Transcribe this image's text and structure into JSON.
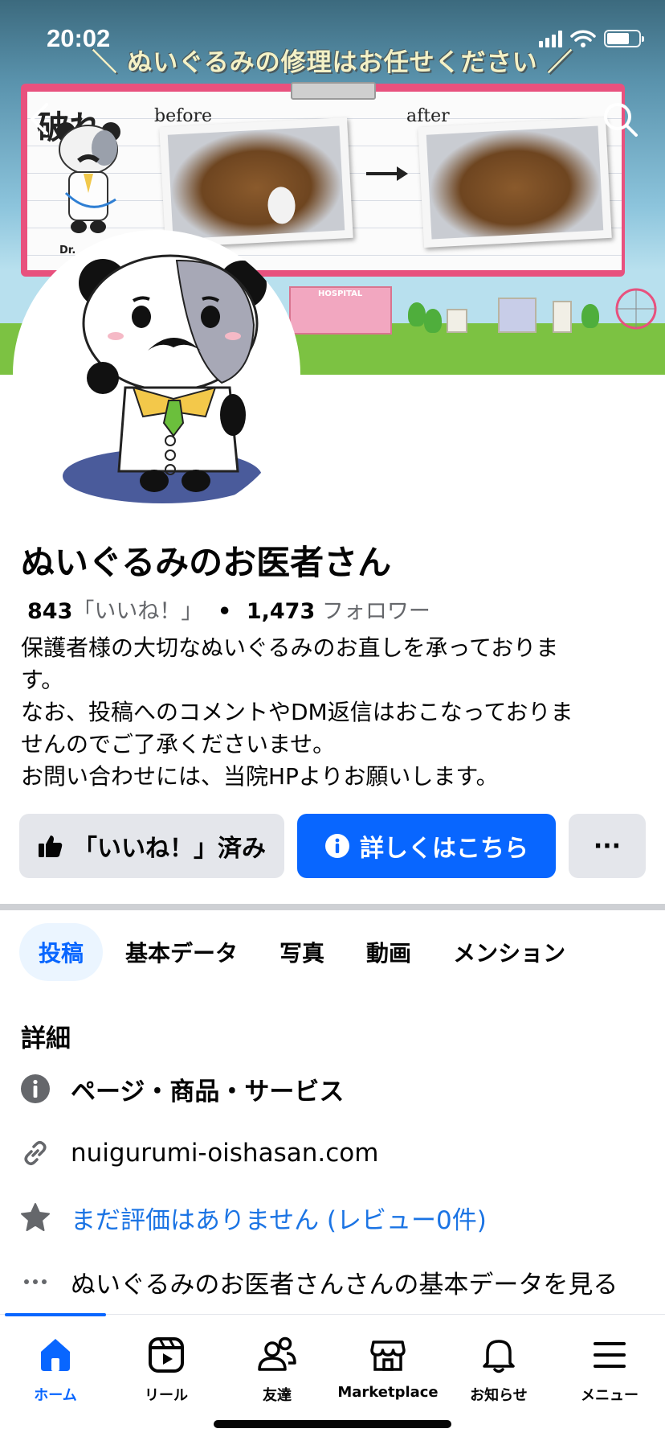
{
  "status_bar": {
    "time": "20:02",
    "icons": [
      "cellular-signal-icon",
      "wifi-icon",
      "battery-icon"
    ]
  },
  "cover": {
    "headline": "＼ ぬいぐるみの修理はお任せください ／",
    "label_tear": "破れ",
    "label_before": "before",
    "label_after": "after",
    "label_dr": "Dr.",
    "label_hospital": "HOSPITAL"
  },
  "top_nav": {
    "back_icon": "chevron-left-icon",
    "search_icon": "search-icon"
  },
  "profile": {
    "name": "ぬいぐるみのお医者さん",
    "likes_count": "843",
    "likes_label": "「いいね！」",
    "separator": "•",
    "followers_count": "1,473",
    "followers_label": "フォロワー",
    "bio_lines": [
      "保護者様の大切なぬいぐるみのお直しを承っておりま",
      "す。",
      "なお、投稿へのコメントやDM返信はおこなっておりま",
      "せんのでご了承くださいませ。",
      "お問い合わせには、当院HPよりお願いします。"
    ]
  },
  "actions": {
    "liked_label": "「いいね！」済み",
    "more_info_label": "詳しくはこちら",
    "overflow_label": "···"
  },
  "tabs": [
    {
      "label": "投稿",
      "active": true
    },
    {
      "label": "基本データ",
      "active": false
    },
    {
      "label": "写真",
      "active": false
    },
    {
      "label": "動画",
      "active": false
    },
    {
      "label": "メンション",
      "active": false
    }
  ],
  "details": {
    "title": "詳細",
    "category": "ページ・商品・サービス",
    "website": "nuigurumi-oishasan.com",
    "rating": "まだ評価はありません (レビュー0件)",
    "see_more": "ぬいぐるみのお医者さんさんの基本データを見る"
  },
  "bottom_nav": [
    {
      "label": "ホーム",
      "icon": "home-icon",
      "active": true
    },
    {
      "label": "リール",
      "icon": "reels-icon",
      "active": false
    },
    {
      "label": "友達",
      "icon": "friends-icon",
      "active": false
    },
    {
      "label": "Marketplace",
      "icon": "marketplace-icon",
      "active": false
    },
    {
      "label": "お知らせ",
      "icon": "bell-icon",
      "active": false
    },
    {
      "label": "メニュー",
      "icon": "menu-icon",
      "active": false
    }
  ],
  "colors": {
    "accent": "#0866ff",
    "link": "#1b74e4",
    "secondary_text": "#65676b",
    "button_grey": "#e4e6eb",
    "tab_active_bg": "#ebf5ff"
  }
}
